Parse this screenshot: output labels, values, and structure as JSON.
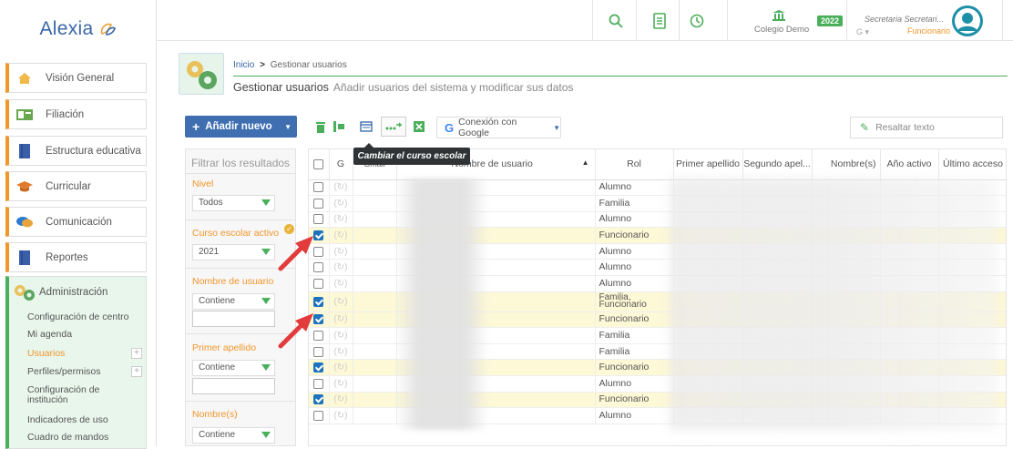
{
  "sidebar": {
    "logo": "Alexia",
    "items": [
      {
        "label": "Visión General"
      },
      {
        "label": "Filiación"
      },
      {
        "label": "Estructura educativa"
      },
      {
        "label": "Curricular"
      },
      {
        "label": "Comunicación"
      },
      {
        "label": "Reportes"
      }
    ],
    "admin": {
      "label": "Administración",
      "subitems": [
        {
          "label": "Configuración de centro"
        },
        {
          "label": "Mi agenda"
        },
        {
          "label": "Usuarios"
        },
        {
          "label": "Perfiles/permisos"
        },
        {
          "label": "Configuración de"
        },
        {
          "label": "institución"
        },
        {
          "label": "Indicadores de uso"
        },
        {
          "label": "Cuadro de mandos"
        }
      ]
    }
  },
  "topbar": {
    "school": "Colegio Demo",
    "year_badge": "2022",
    "user_name": "Secretaria Secretari...",
    "user_role": "Funcionario"
  },
  "breadcrumb": {
    "home": "Inicio",
    "separator": ">",
    "current": "Gestionar usuarios",
    "title": "Gestionar usuarios",
    "subtitle": "Añadir usuarios del sistema y modificar sus datos"
  },
  "toolbar": {
    "add_label": "Añadir nuevo",
    "google_label": "Conexión con Google",
    "highlight_placeholder": "Resaltar texto",
    "tooltip": "Cambiar el curso escolar"
  },
  "filters": {
    "title": "Filtrar los resultados",
    "nivel_label": "Nivel",
    "nivel_value": "Todos",
    "curso_label": "Curso escolar activo",
    "curso_value": "2021",
    "usuario_label": "Nombre de usuario",
    "usuario_mode": "Contiene",
    "apellido_label": "Primer apellido",
    "apellido_mode": "Contiene",
    "nombre_label": "Nombre(s)",
    "nombre_mode": "Contiene"
  },
  "table": {
    "headers": {
      "g": "G",
      "gmail": "Gmail",
      "user": "Nombre de usuario",
      "rol": "Rol",
      "ap1": "Primer apellido",
      "ap2": "Segundo apel...",
      "nombre": "Nombre(s)",
      "anio": "Año activo",
      "acceso": "Último acceso"
    },
    "rows": [
      {
        "rol": "Alumno",
        "checked": false
      },
      {
        "rol": "Familia",
        "checked": false
      },
      {
        "rol": "Alumno",
        "checked": false
      },
      {
        "rol": "Funcionario",
        "checked": true
      },
      {
        "rol": "Alumno",
        "checked": false
      },
      {
        "rol": "Alumno",
        "checked": false
      },
      {
        "rol": "Alumno",
        "checked": false
      },
      {
        "rol": "Familia, Funcionario",
        "checked": true
      },
      {
        "rol": "Funcionario",
        "checked": true
      },
      {
        "rol": "Familia",
        "checked": false
      },
      {
        "rol": "Familia",
        "checked": false
      },
      {
        "rol": "Funcionario",
        "checked": true
      },
      {
        "rol": "Alumno",
        "checked": false
      },
      {
        "rol": "Funcionario",
        "checked": true
      },
      {
        "rol": "Alumno",
        "checked": false
      }
    ]
  },
  "colors": {
    "accent_orange": "#f0962b",
    "accent_green": "#4aaf5a",
    "primary_blue": "#3f6fb0",
    "selected_row": "#fdf8d6",
    "arrow_red": "#e23b3b"
  }
}
